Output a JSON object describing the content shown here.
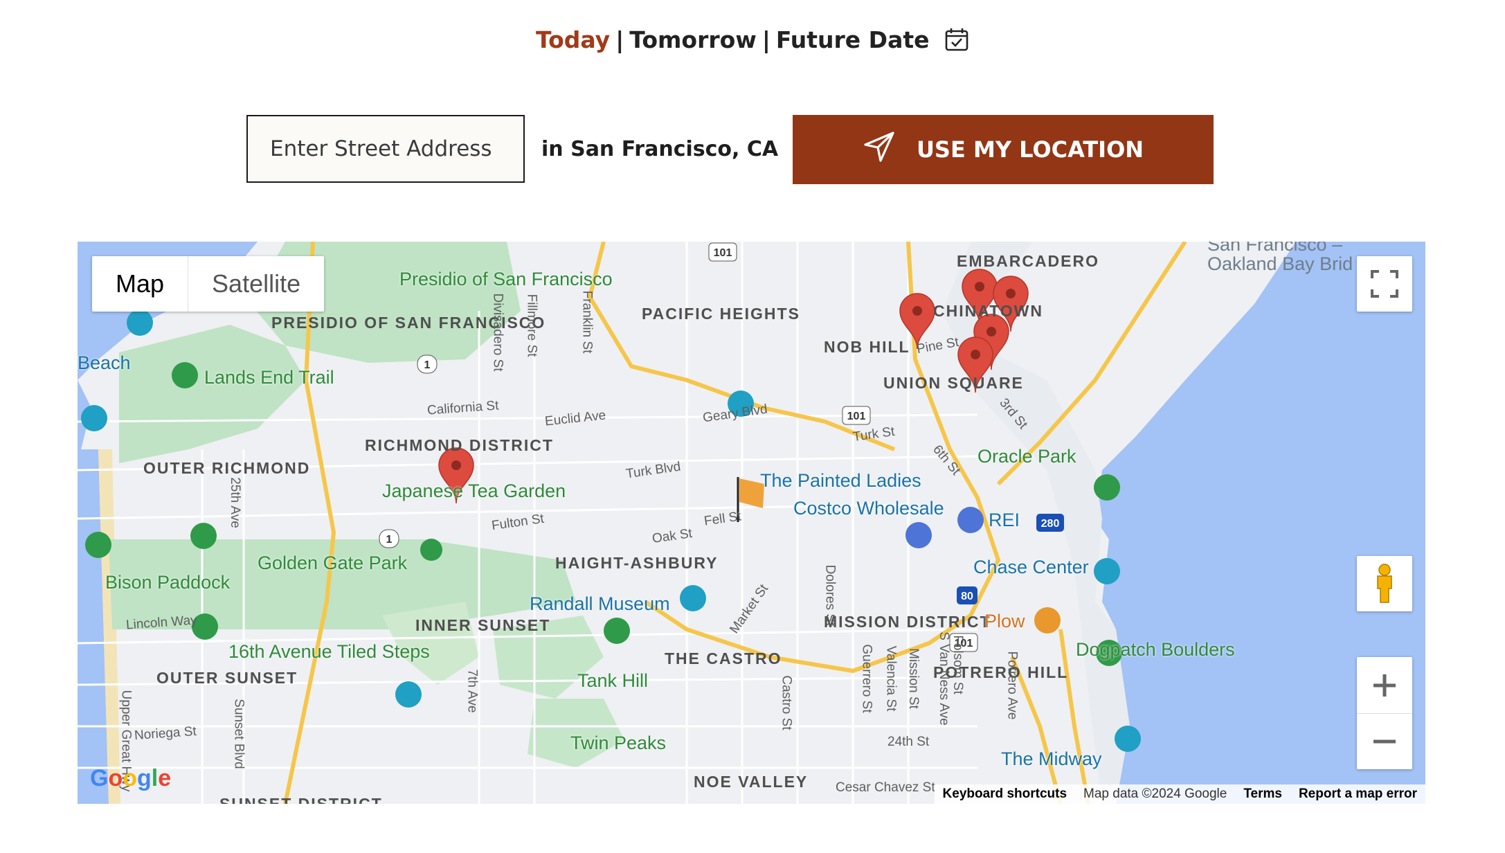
{
  "date_tabs": {
    "today": "Today",
    "separator": "|",
    "tomorrow": "Tomorrow",
    "future": "Future Date",
    "active_color": "#a23a18"
  },
  "search": {
    "placeholder": "Enter Street Address",
    "city": "in San Francisco, CA",
    "location_button": "USE MY LOCATION",
    "button_color": "#933616"
  },
  "map": {
    "type_map": "Map",
    "type_satellite": "Satellite",
    "footer": {
      "shortcuts": "Keyboard shortcuts",
      "data": "Map data ©2024 Google",
      "terms": "Terms",
      "report": "Report a map error"
    },
    "districts": [
      "PRESIDIO OF SAN FRANCISCO",
      "PACIFIC HEIGHTS",
      "NOB HILL",
      "EMBARCADERO",
      "CHINATOWN",
      "UNION SQUARE",
      "RICHMOND DISTRICT",
      "OUTER RICHMOND",
      "HAIGHT-ASHBURY",
      "INNER SUNSET",
      "OUTER SUNSET",
      "THE CASTRO",
      "MISSION DISTRICT",
      "POTRERO HILL",
      "NOE VALLEY",
      "SUNSET DISTRICT"
    ],
    "places": [
      "Presidio of San Francisco",
      "Lands End Trail",
      "Japanese Tea Garden",
      "Golden Gate Park",
      "Bison Paddock",
      "16th Avenue Tiled Steps",
      "Tank Hill",
      "Twin Peaks",
      "Randall Museum",
      "The Painted Ladies",
      "Costco Wholesale",
      "REI",
      "Oracle Park",
      "Chase Center",
      "Plow",
      "Dogpatch Boulders",
      "The Midway",
      "San Francisco – Oakland Bay Brid",
      "Beach"
    ],
    "streets": [
      "California St",
      "Euclid Ave",
      "Geary Blvd",
      "Turk St",
      "Turk Blvd",
      "Fulton St",
      "Oak St",
      "Fell St",
      "Pine St",
      "3rd St",
      "6th St",
      "Lincoln Way",
      "Noriega St",
      "Sunset Blvd",
      "7th Ave",
      "25th Ave",
      "Divisadero St",
      "Fillmore St",
      "Franklin St",
      "Market St",
      "Dolores St",
      "Castro St",
      "Guerrero St",
      "Valencia St",
      "Mission St",
      "S Van Ness Ave",
      "Folsom St",
      "Potrero Ave",
      "24th St",
      "Cesar Chavez St",
      "Upper Great Hwy"
    ],
    "highways": [
      "101",
      "1",
      "80",
      "280"
    ],
    "marker_count": 7,
    "marker_color": "#dd4b3e",
    "water_color": "#a3c2f5"
  }
}
